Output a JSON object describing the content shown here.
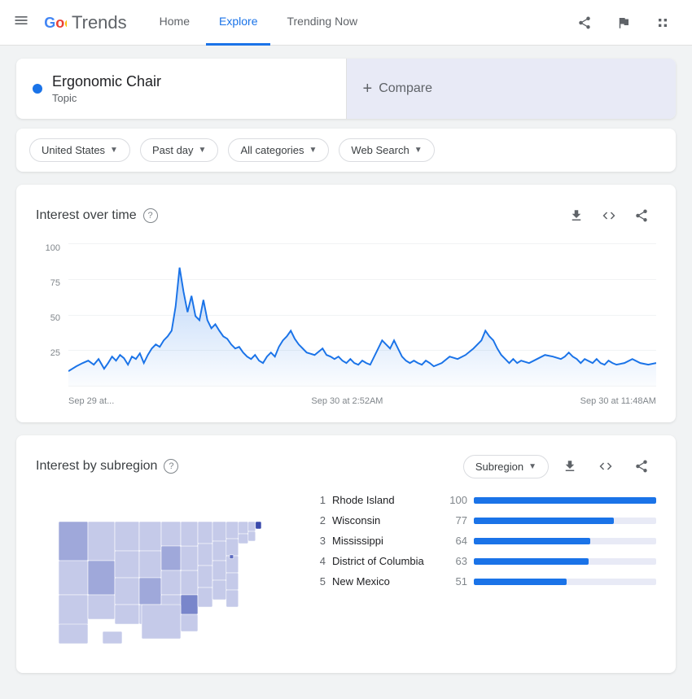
{
  "header": {
    "logo": "Google Trends",
    "nav": [
      {
        "label": "Home",
        "active": false
      },
      {
        "label": "Explore",
        "active": true
      },
      {
        "label": "Trending Now",
        "active": false
      }
    ]
  },
  "search": {
    "term": "Ergonomic Chair",
    "type": "Topic",
    "compare_label": "Compare"
  },
  "filters": {
    "location": "United States",
    "time": "Past day",
    "category": "All categories",
    "search_type": "Web Search"
  },
  "interest_over_time": {
    "title": "Interest over time",
    "y_labels": [
      "100",
      "75",
      "50",
      "25"
    ],
    "x_labels": [
      "Sep 29 at...",
      "Sep 30 at 2:52AM",
      "Sep 30 at 11:48AM"
    ]
  },
  "interest_by_subregion": {
    "title": "Interest by subregion",
    "dropdown": "Subregion",
    "regions": [
      {
        "rank": 1,
        "name": "Rhode Island",
        "value": 100,
        "bar_pct": 100
      },
      {
        "rank": 2,
        "name": "Wisconsin",
        "value": 77,
        "bar_pct": 77
      },
      {
        "rank": 3,
        "name": "Mississippi",
        "value": 64,
        "bar_pct": 64
      },
      {
        "rank": 4,
        "name": "District of Columbia",
        "value": 63,
        "bar_pct": 63
      },
      {
        "rank": 5,
        "name": "New Mexico",
        "value": 51,
        "bar_pct": 51
      }
    ]
  }
}
